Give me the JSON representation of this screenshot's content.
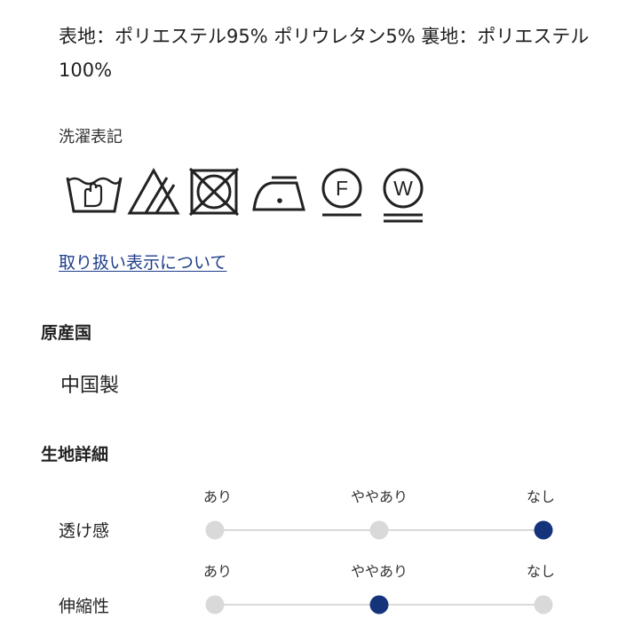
{
  "material": {
    "text": "表地：ポリエステル95% ポリウレタン5% 裏地：ポリエステル100%"
  },
  "care": {
    "heading": "洗濯表記",
    "icons": [
      {
        "name": "hand-wash-icon"
      },
      {
        "name": "no-bleach-icon"
      },
      {
        "name": "no-tumble-dry-icon"
      },
      {
        "name": "iron-low-icon"
      },
      {
        "name": "dry-clean-f-icon",
        "letter": "F"
      },
      {
        "name": "wet-clean-w-icon",
        "letter": "W"
      }
    ],
    "link_label": "取り扱い表示について"
  },
  "origin": {
    "title": "原産国",
    "value": "中国製"
  },
  "fabric": {
    "title": "生地詳細",
    "scales": [
      {
        "label": "透け感",
        "options": [
          "あり",
          "ややあり",
          "なし"
        ],
        "selected_index": 2
      },
      {
        "label": "伸縮性",
        "options": [
          "あり",
          "ややあり",
          "なし"
        ],
        "selected_index": 1
      }
    ]
  },
  "colors": {
    "link": "#1f3d8a",
    "selected_dot": "#14337a",
    "inactive_dot": "#d9d9d9"
  }
}
